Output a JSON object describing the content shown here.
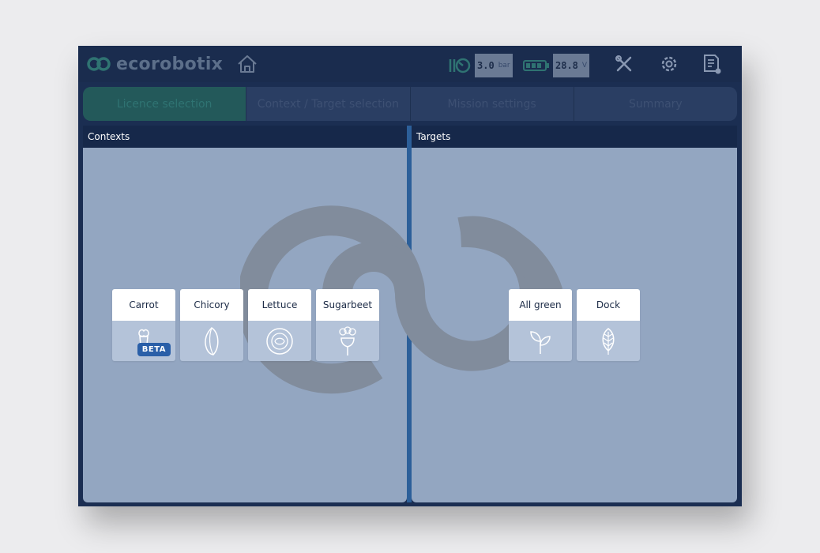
{
  "app": {
    "logo_text": "ecorobotix"
  },
  "status": {
    "pressure_value": "3.0",
    "pressure_unit": "bar",
    "voltage_value": "28.8",
    "voltage_unit": "V"
  },
  "steps": [
    {
      "label": "Licence selection",
      "active": true
    },
    {
      "label": "Context / Target selection",
      "active": false
    },
    {
      "label": "Mission settings",
      "active": false
    },
    {
      "label": "Summary",
      "active": false
    }
  ],
  "contexts": {
    "title": "Contexts",
    "items": [
      {
        "label": "Carrot",
        "icon": "carrot-icon",
        "badge": "BETA"
      },
      {
        "label": "Chicory",
        "icon": "chicory-icon"
      },
      {
        "label": "Lettuce",
        "icon": "lettuce-icon"
      },
      {
        "label": "Sugarbeet",
        "icon": "sugarbeet-icon"
      }
    ]
  },
  "targets": {
    "title": "Targets",
    "items": [
      {
        "label": "All green",
        "icon": "sprout-icon"
      },
      {
        "label": "Dock",
        "icon": "dock-leaf-icon"
      }
    ]
  },
  "colors": {
    "brand": "#1b2e52",
    "active_step": "#23595a",
    "panel_bg": "#93a6c1",
    "accent": "#2c5f99",
    "beta_badge": "#2a5fa8"
  }
}
